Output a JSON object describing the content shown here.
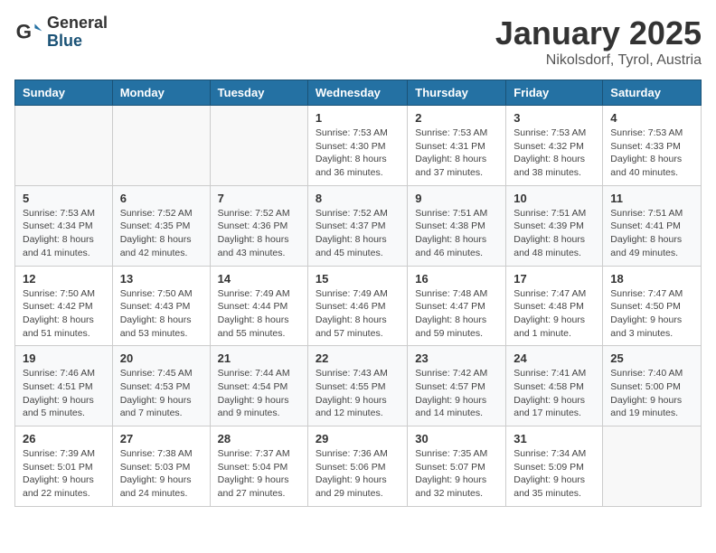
{
  "header": {
    "logo_general": "General",
    "logo_blue": "Blue",
    "title": "January 2025",
    "subtitle": "Nikolsdorf, Tyrol, Austria"
  },
  "days_of_week": [
    "Sunday",
    "Monday",
    "Tuesday",
    "Wednesday",
    "Thursday",
    "Friday",
    "Saturday"
  ],
  "weeks": [
    [
      {
        "day": "",
        "info": ""
      },
      {
        "day": "",
        "info": ""
      },
      {
        "day": "",
        "info": ""
      },
      {
        "day": "1",
        "info": "Sunrise: 7:53 AM\nSunset: 4:30 PM\nDaylight: 8 hours and 36 minutes."
      },
      {
        "day": "2",
        "info": "Sunrise: 7:53 AM\nSunset: 4:31 PM\nDaylight: 8 hours and 37 minutes."
      },
      {
        "day": "3",
        "info": "Sunrise: 7:53 AM\nSunset: 4:32 PM\nDaylight: 8 hours and 38 minutes."
      },
      {
        "day": "4",
        "info": "Sunrise: 7:53 AM\nSunset: 4:33 PM\nDaylight: 8 hours and 40 minutes."
      }
    ],
    [
      {
        "day": "5",
        "info": "Sunrise: 7:53 AM\nSunset: 4:34 PM\nDaylight: 8 hours and 41 minutes."
      },
      {
        "day": "6",
        "info": "Sunrise: 7:52 AM\nSunset: 4:35 PM\nDaylight: 8 hours and 42 minutes."
      },
      {
        "day": "7",
        "info": "Sunrise: 7:52 AM\nSunset: 4:36 PM\nDaylight: 8 hours and 43 minutes."
      },
      {
        "day": "8",
        "info": "Sunrise: 7:52 AM\nSunset: 4:37 PM\nDaylight: 8 hours and 45 minutes."
      },
      {
        "day": "9",
        "info": "Sunrise: 7:51 AM\nSunset: 4:38 PM\nDaylight: 8 hours and 46 minutes."
      },
      {
        "day": "10",
        "info": "Sunrise: 7:51 AM\nSunset: 4:39 PM\nDaylight: 8 hours and 48 minutes."
      },
      {
        "day": "11",
        "info": "Sunrise: 7:51 AM\nSunset: 4:41 PM\nDaylight: 8 hours and 49 minutes."
      }
    ],
    [
      {
        "day": "12",
        "info": "Sunrise: 7:50 AM\nSunset: 4:42 PM\nDaylight: 8 hours and 51 minutes."
      },
      {
        "day": "13",
        "info": "Sunrise: 7:50 AM\nSunset: 4:43 PM\nDaylight: 8 hours and 53 minutes."
      },
      {
        "day": "14",
        "info": "Sunrise: 7:49 AM\nSunset: 4:44 PM\nDaylight: 8 hours and 55 minutes."
      },
      {
        "day": "15",
        "info": "Sunrise: 7:49 AM\nSunset: 4:46 PM\nDaylight: 8 hours and 57 minutes."
      },
      {
        "day": "16",
        "info": "Sunrise: 7:48 AM\nSunset: 4:47 PM\nDaylight: 8 hours and 59 minutes."
      },
      {
        "day": "17",
        "info": "Sunrise: 7:47 AM\nSunset: 4:48 PM\nDaylight: 9 hours and 1 minute."
      },
      {
        "day": "18",
        "info": "Sunrise: 7:47 AM\nSunset: 4:50 PM\nDaylight: 9 hours and 3 minutes."
      }
    ],
    [
      {
        "day": "19",
        "info": "Sunrise: 7:46 AM\nSunset: 4:51 PM\nDaylight: 9 hours and 5 minutes."
      },
      {
        "day": "20",
        "info": "Sunrise: 7:45 AM\nSunset: 4:53 PM\nDaylight: 9 hours and 7 minutes."
      },
      {
        "day": "21",
        "info": "Sunrise: 7:44 AM\nSunset: 4:54 PM\nDaylight: 9 hours and 9 minutes."
      },
      {
        "day": "22",
        "info": "Sunrise: 7:43 AM\nSunset: 4:55 PM\nDaylight: 9 hours and 12 minutes."
      },
      {
        "day": "23",
        "info": "Sunrise: 7:42 AM\nSunset: 4:57 PM\nDaylight: 9 hours and 14 minutes."
      },
      {
        "day": "24",
        "info": "Sunrise: 7:41 AM\nSunset: 4:58 PM\nDaylight: 9 hours and 17 minutes."
      },
      {
        "day": "25",
        "info": "Sunrise: 7:40 AM\nSunset: 5:00 PM\nDaylight: 9 hours and 19 minutes."
      }
    ],
    [
      {
        "day": "26",
        "info": "Sunrise: 7:39 AM\nSunset: 5:01 PM\nDaylight: 9 hours and 22 minutes."
      },
      {
        "day": "27",
        "info": "Sunrise: 7:38 AM\nSunset: 5:03 PM\nDaylight: 9 hours and 24 minutes."
      },
      {
        "day": "28",
        "info": "Sunrise: 7:37 AM\nSunset: 5:04 PM\nDaylight: 9 hours and 27 minutes."
      },
      {
        "day": "29",
        "info": "Sunrise: 7:36 AM\nSunset: 5:06 PM\nDaylight: 9 hours and 29 minutes."
      },
      {
        "day": "30",
        "info": "Sunrise: 7:35 AM\nSunset: 5:07 PM\nDaylight: 9 hours and 32 minutes."
      },
      {
        "day": "31",
        "info": "Sunrise: 7:34 AM\nSunset: 5:09 PM\nDaylight: 9 hours and 35 minutes."
      },
      {
        "day": "",
        "info": ""
      }
    ]
  ]
}
